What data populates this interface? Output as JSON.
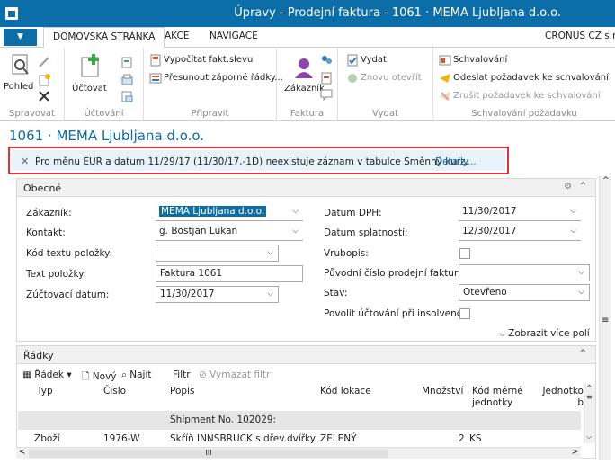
{
  "window": {
    "title": "Úpravy - Prodejní faktura - 1061 · MEMA Ljubljana d.o.o."
  },
  "tabs": [
    "DOMOVSKÁ STRÁNKA",
    "AKCE",
    "NAVIGACE"
  ],
  "company": "CRONUS CZ s.r.",
  "ribbon": {
    "spravovat": {
      "label": "Spravovat",
      "pohled": "Pohled"
    },
    "uctovani": {
      "label": "Účtování",
      "uctovat": "Účtovat"
    },
    "pripravit": {
      "label": "Připravit",
      "vypocitat": "Vypočítat fakt.slevu",
      "presunout": "Přesunout záporné řádky..."
    },
    "faktura": {
      "label": "Faktura",
      "zakaznik": "Zákazník"
    },
    "vydat": {
      "label": "Vydat",
      "vydat": "Vydat",
      "znovu": "Znovu otevřít"
    },
    "schvalovani": {
      "label": "Schvalování požadavku",
      "schvalovani": "Schvalování",
      "odeslat": "Odeslat požadavek ke schvalování",
      "zrusit": "Zrušit požadavek ke schvalování"
    }
  },
  "page_title": "1061 · MEMA Ljubljana d.o.o.",
  "notification": {
    "message": "Pro měnu EUR a datum 11/29/17 (11/30/17,-1D) neexistuje záznam v tabulce Směnný kurz.",
    "link": "Detaily..."
  },
  "general": {
    "title": "Obecné",
    "zakaznik_label": "Zákazník:",
    "zakaznik_value": "MEMA Ljubljana d.o.o.",
    "kontakt_label": "Kontakt:",
    "kontakt_value": "g. Bostjan Lukan",
    "kod_textu_label": "Kód textu položky:",
    "kod_textu_value": "",
    "text_label": "Text položky:",
    "text_value": "Faktura 1061",
    "zuct_label": "Zúčtovací datum:",
    "zuct_value": "11/30/2017",
    "dph_label": "Datum DPH:",
    "dph_value": "11/30/2017",
    "splat_label": "Datum splatnosti:",
    "splat_value": "12/30/2017",
    "vrubopis_label": "Vrubopis:",
    "puvodni_label": "Původní číslo prodejní faktury:",
    "puvodni_value": "",
    "stav_label": "Stav:",
    "stav_value": "Otevřeno",
    "insolv_label": "Povolit účtování při insolvenci:",
    "more_label": "Zobrazit více polí"
  },
  "lines": {
    "title": "Řádky",
    "toolbar": {
      "radek": "Řádek",
      "novy": "Nový",
      "najit": "Najít",
      "filtr": "Filtr",
      "vymazat": "Vymazat filtr"
    },
    "columns": [
      "Typ",
      "Číslo",
      "Popis",
      "Kód lokace",
      "Množství",
      "Kód měrné jednotky",
      "Jednotko b"
    ],
    "rows": [
      {
        "typ": "",
        "cislo": "",
        "popis": "Shipment No. 102029:",
        "lokace": "",
        "mnozstvi": "",
        "mj": ""
      },
      {
        "typ": "Zboží",
        "cislo": "1976-W",
        "popis": "Skříň INNSBRUCK s dřev.dvířky",
        "lokace": "ZELENÝ",
        "mnozstvi": "2",
        "mj": "KS"
      }
    ]
  },
  "scroll": {
    "hscroll_thumb": "III"
  }
}
